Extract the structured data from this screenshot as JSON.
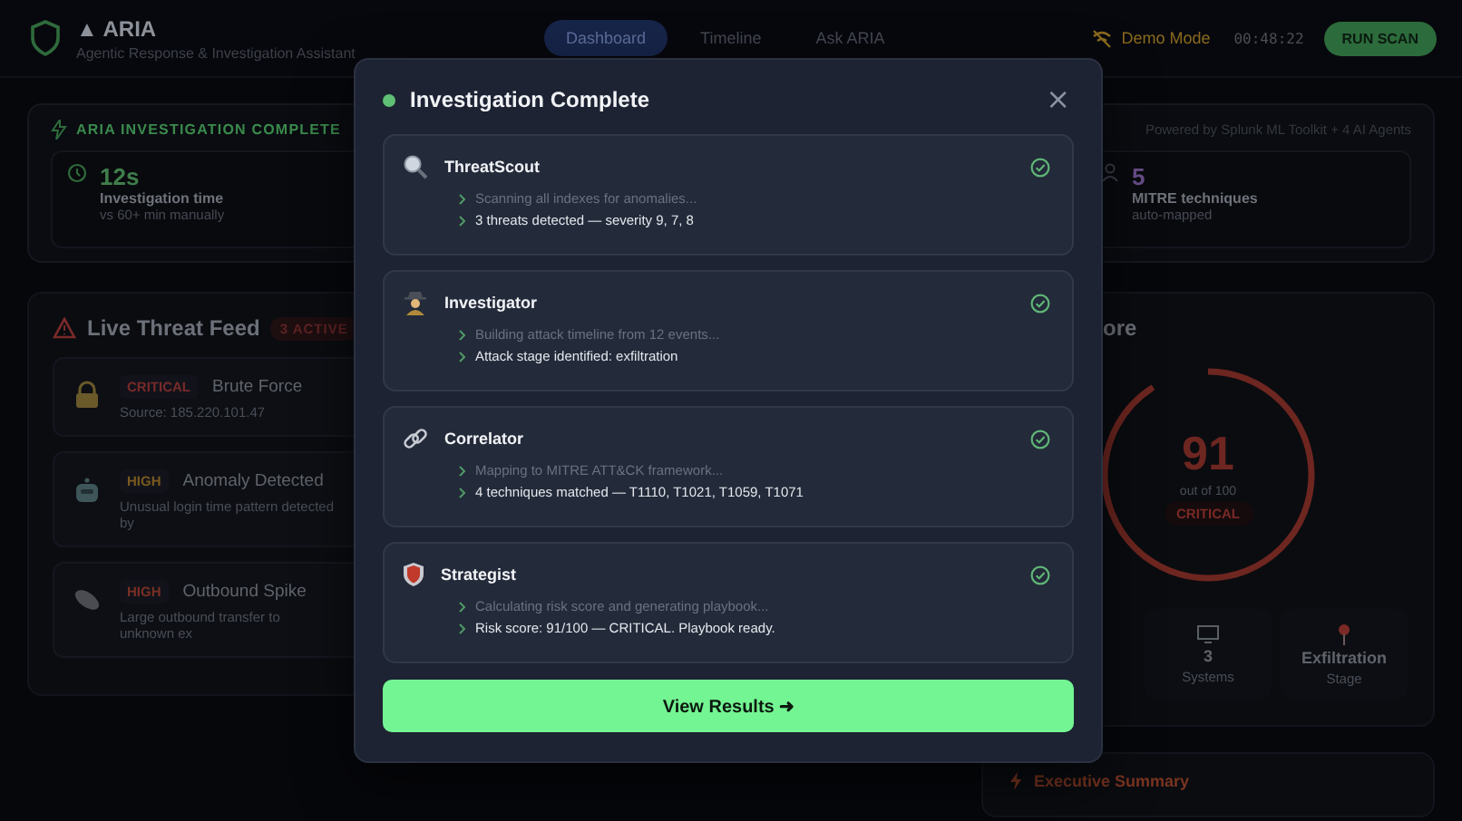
{
  "header": {
    "title": "▲ ARIA",
    "subtitle": "Agentic Response & Investigation Assistant",
    "tabs": [
      {
        "label": "Dashboard",
        "selected": true
      },
      {
        "label": "Timeline",
        "selected": false
      },
      {
        "label": "Ask ARIA",
        "selected": false
      }
    ],
    "demo_mode": "Demo Mode",
    "clock": "00:48:22",
    "run_button": "RUN SCAN"
  },
  "banner": {
    "title": "ARIA INVESTIGATION COMPLETE",
    "powered_by": "Powered by Splunk ML Toolkit + 4 AI Agents",
    "stats": [
      {
        "value": "12s",
        "label": "Investigation time",
        "note": "vs 60+ min manually",
        "color": "#3f7d4b"
      },
      {
        "value": "5",
        "label": "MITRE techniques",
        "note": "auto-mapped",
        "color": "#6a4f8a"
      }
    ]
  },
  "threat_feed": {
    "title": "Live Threat Feed",
    "badge": "3 ACTIVE",
    "items": [
      {
        "severity": "CRITICAL",
        "color": "#7a2a2a",
        "title": "Brute Force",
        "description": "Source: 185.220.101.47"
      },
      {
        "severity": "HIGH",
        "color": "#7a5a1e",
        "title": "Anomaly Detected",
        "description": "Unusual login time pattern detected by"
      },
      {
        "severity": "HIGH",
        "color": "#7a2f24",
        "title": "Outbound Spike",
        "description": "Large outbound transfer to unknown ex"
      }
    ]
  },
  "risk": {
    "title": "ore",
    "score": "91",
    "level": 0.91,
    "out_of": "out of 100",
    "rating": "CRITICAL",
    "stats": [
      {
        "value": "3",
        "label": "Systems"
      },
      {
        "value": "Exfiltration",
        "label": "Stage"
      }
    ]
  },
  "summary": {
    "title": "Executive Summary"
  },
  "modal": {
    "title": "Investigation Complete",
    "close": "×",
    "agents": [
      {
        "name": "ThreatScout",
        "done": true,
        "lines": [
          {
            "kind": "step",
            "text": "Scanning all indexes for anomalies..."
          },
          {
            "kind": "result",
            "text": "3 threats detected — severity 9, 7, 8"
          }
        ]
      },
      {
        "name": "Investigator",
        "done": true,
        "lines": [
          {
            "kind": "step",
            "text": "Building attack timeline from 12 events..."
          },
          {
            "kind": "result",
            "text": "Attack stage identified: exfiltration"
          }
        ]
      },
      {
        "name": "Correlator",
        "done": true,
        "lines": [
          {
            "kind": "step",
            "text": "Mapping to MITRE ATT&CK framework..."
          },
          {
            "kind": "result",
            "text": "4 techniques matched — T1110, T1021, T1059, T1071"
          }
        ]
      },
      {
        "name": "Strategist",
        "done": true,
        "lines": [
          {
            "kind": "step",
            "text": "Calculating risk score and generating playbook..."
          },
          {
            "kind": "result",
            "text": "Risk score: 91/100 — CRITICAL. Playbook ready."
          }
        ]
      }
    ],
    "button": "View Results ➜"
  }
}
